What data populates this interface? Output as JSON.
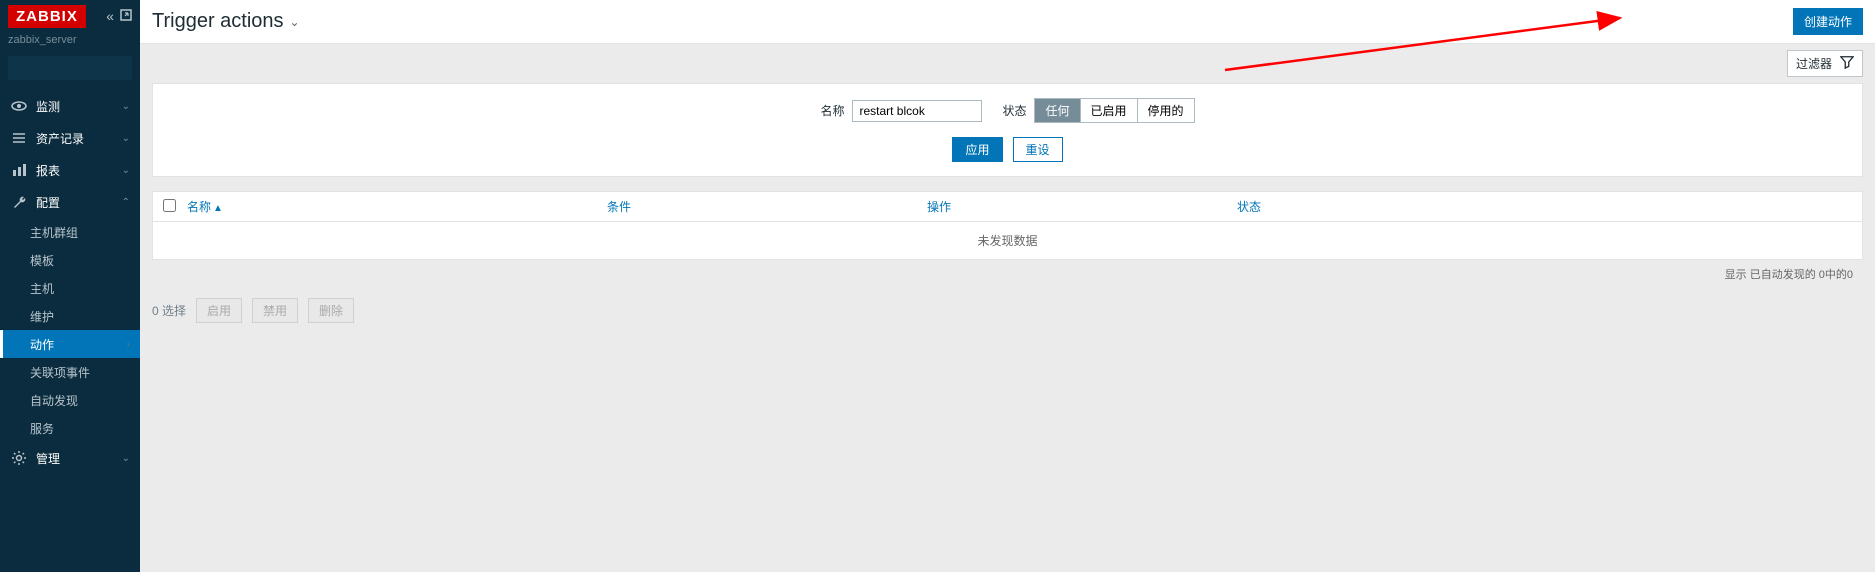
{
  "brand": "ZABBIX",
  "server_name": "zabbix_server",
  "nav": {
    "monitor": "监测",
    "inventory": "资产记录",
    "reports": "报表",
    "config": "配置",
    "admin": "管理"
  },
  "config_sub": {
    "hostgroups": "主机群组",
    "templates": "模板",
    "hosts": "主机",
    "maintenance": "维护",
    "actions": "动作",
    "correlation": "关联项事件",
    "discovery": "自动发现",
    "services": "服务"
  },
  "page": {
    "title": "Trigger actions",
    "create_btn": "创建动作",
    "filter_toggle": "过滤器"
  },
  "filter": {
    "name_label": "名称",
    "name_value": "restart blcok",
    "status_label": "状态",
    "status_any": "任何",
    "status_enabled": "已启用",
    "status_disabled": "停用的",
    "apply": "应用",
    "reset": "重设"
  },
  "table": {
    "col_name": "名称",
    "col_cond": "条件",
    "col_op": "操作",
    "col_status": "状态",
    "no_data": "未发现数据",
    "footer": "显示 已自动发现的 0中的0"
  },
  "bulk": {
    "selected": "0 选择",
    "enable": "启用",
    "disable": "禁用",
    "delete": "删除"
  }
}
